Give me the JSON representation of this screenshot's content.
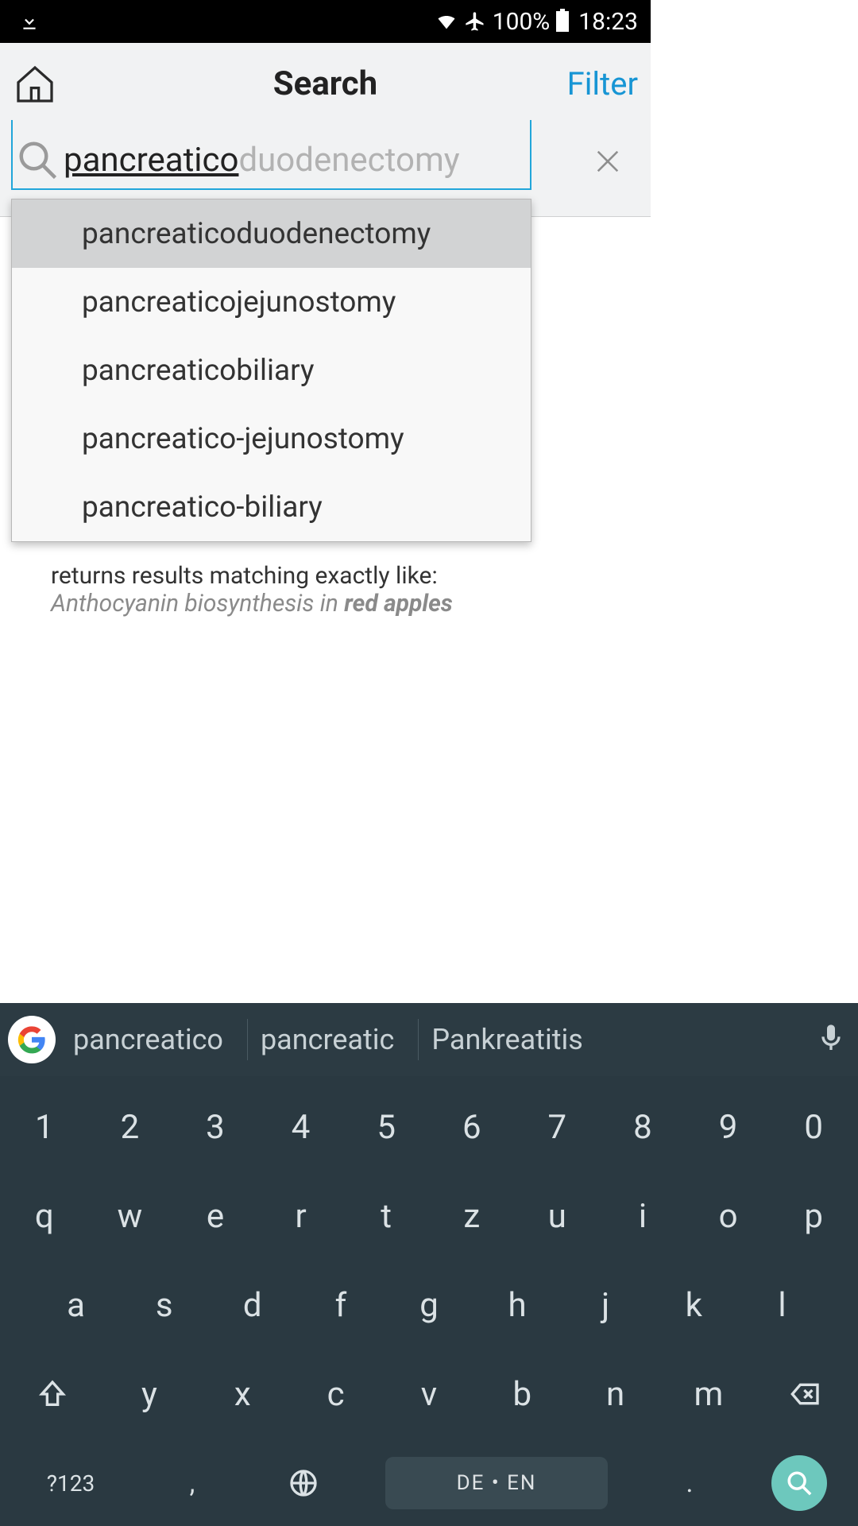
{
  "status": {
    "battery_pct": "100%",
    "time": "18:23"
  },
  "header": {
    "title": "Search",
    "filter_label": "Filter"
  },
  "search": {
    "typed": "pancreatico",
    "autocomplete_tail": "duodenectomy"
  },
  "suggestions": [
    "pancreaticoduodenectomy",
    "pancreaticojejunostomy",
    "pancreaticobiliary",
    "pancreatico-jejunostomy",
    "pancreatico-biliary"
  ],
  "hint": {
    "line1": "returns results matching exactly like:",
    "line2_italic": "Anthocyanin biosynthesis in ",
    "line2_bold": "red apples"
  },
  "keyboard": {
    "suggestions": [
      "pancreatico",
      "pancreatic",
      "Pankreatitis"
    ],
    "row_num": [
      "1",
      "2",
      "3",
      "4",
      "5",
      "6",
      "7",
      "8",
      "9",
      "0"
    ],
    "row_top": [
      "q",
      "w",
      "e",
      "r",
      "t",
      "z",
      "u",
      "i",
      "o",
      "p"
    ],
    "row_mid": [
      "a",
      "s",
      "d",
      "f",
      "g",
      "h",
      "j",
      "k",
      "l"
    ],
    "row_bot": [
      "y",
      "x",
      "c",
      "v",
      "b",
      "n",
      "m"
    ],
    "mode_label": "?123",
    "comma": ",",
    "space_label": "DE • EN",
    "period": "."
  }
}
